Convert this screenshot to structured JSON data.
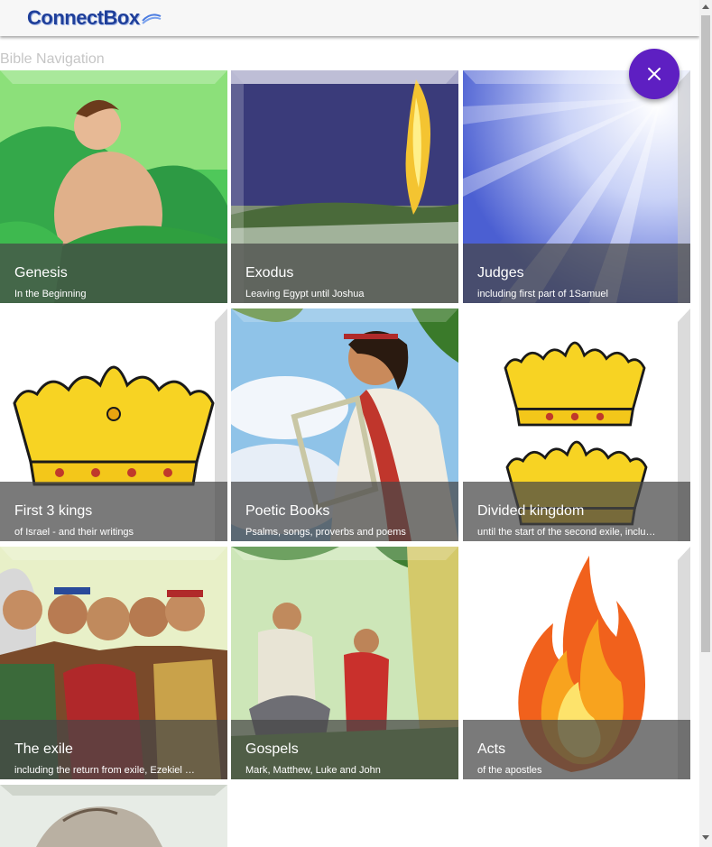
{
  "app": {
    "logo_text": "ConnectBox"
  },
  "page": {
    "nav_title": "Bible Navigation",
    "close_icon": "close-icon"
  },
  "colors": {
    "fab": "#5e1fc2",
    "caption_overlay": "rgba(70,70,70,0.72)",
    "logo": "#1f3f9a"
  },
  "tiles": [
    {
      "title": "Genesis",
      "subtitle": "In the Beginning",
      "image": "man-in-garden-image"
    },
    {
      "title": "Exodus",
      "subtitle": "Leaving Egypt until Joshua",
      "image": "pillar-of-fire-image"
    },
    {
      "title": "Judges",
      "subtitle": "including first part of 1Samuel",
      "image": "light-rays-image"
    },
    {
      "title": "First 3 kings",
      "subtitle": "of Israel - and their writings",
      "image": "crown-image"
    },
    {
      "title": "Poetic Books",
      "subtitle": "Psalms, songs, proverbs and poems",
      "image": "harp-player-image"
    },
    {
      "title": "Divided kingdom",
      "subtitle": "until the start of the second exile, inclu…",
      "image": "two-crowns-image"
    },
    {
      "title": "The exile",
      "subtitle": "including the return from exile, Ezekiel …",
      "image": "captives-in-chains-image"
    },
    {
      "title": "Gospels",
      "subtitle": "Mark, Matthew, Luke and John",
      "image": "jesus-on-donkey-image"
    },
    {
      "title": "Acts",
      "subtitle": "of the apostles",
      "image": "flame-image"
    },
    {
      "title": "",
      "subtitle": "",
      "image": "partial-tile-image"
    }
  ]
}
